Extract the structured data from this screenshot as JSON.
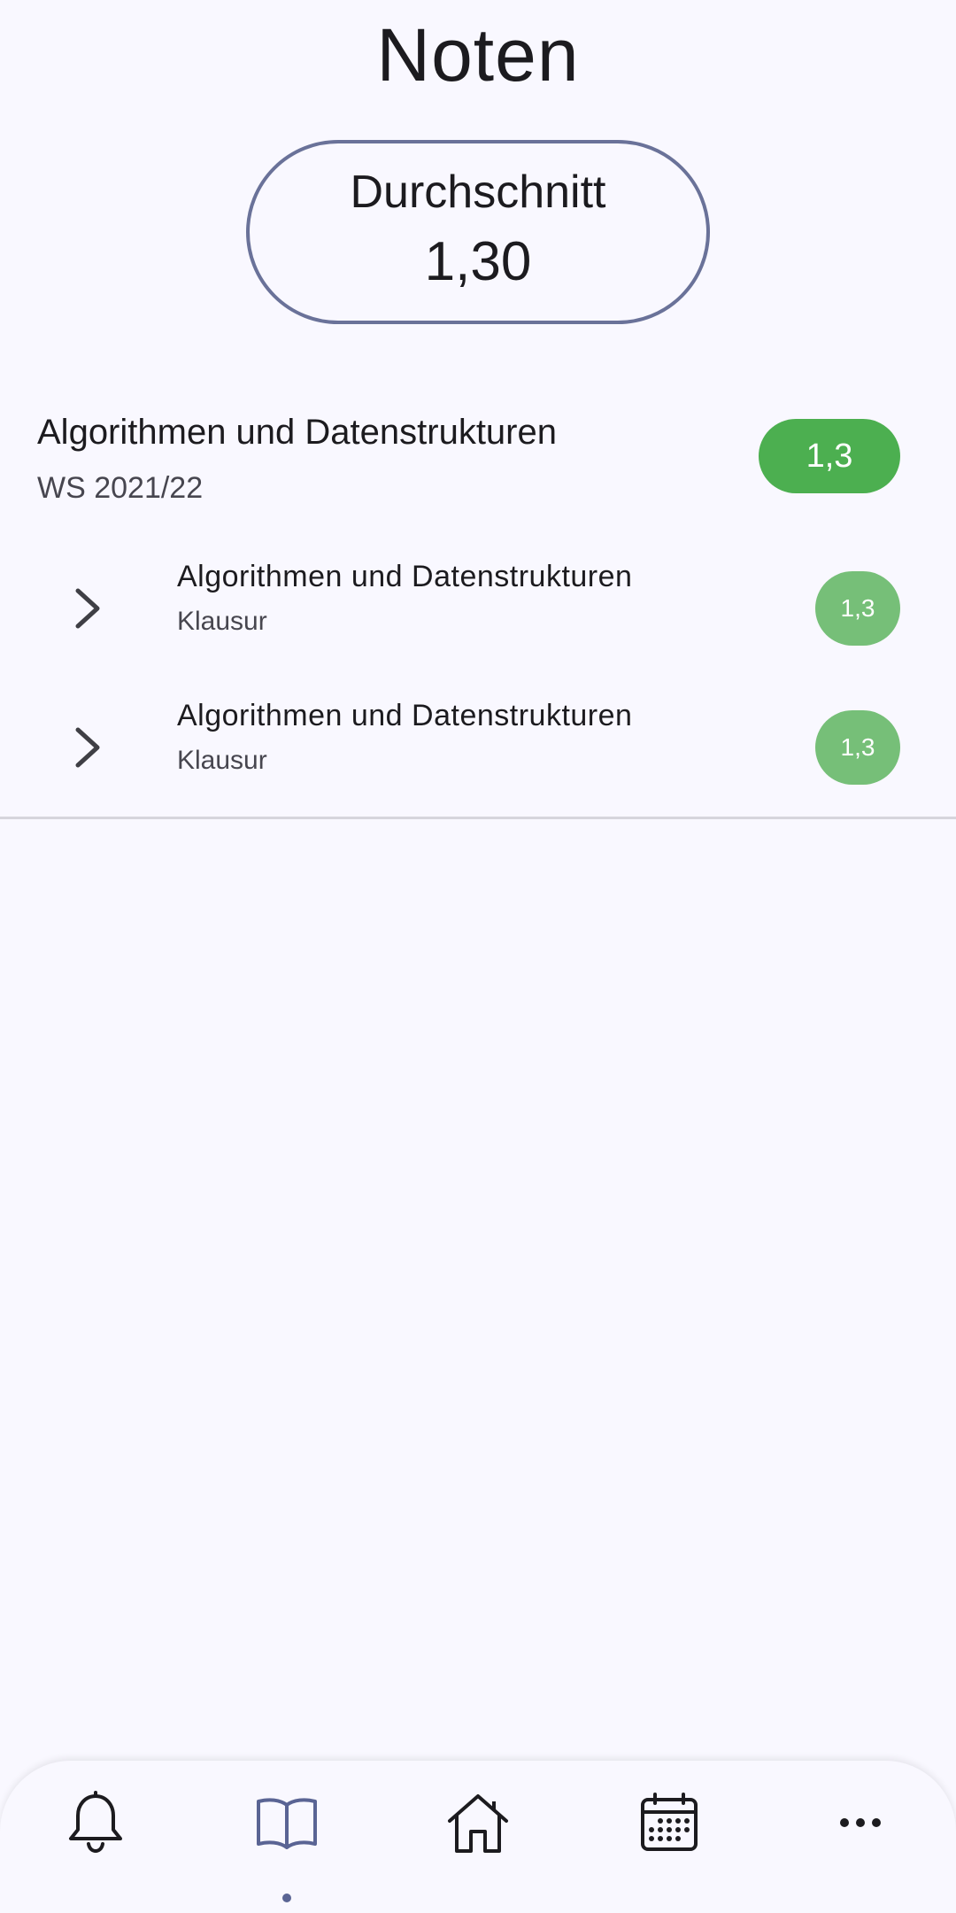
{
  "header": {
    "title": "Noten"
  },
  "average": {
    "label": "Durchschnitt",
    "value": "1,30"
  },
  "module": {
    "title": "Algorithmen und Datenstrukturen",
    "term": "WS 2021/22",
    "grade": "1,3",
    "exams": [
      {
        "name": "Algorithmen und Datenstrukturen",
        "type": "Klausur",
        "grade": "1,3"
      },
      {
        "name": "Algorithmen und Datenstrukturen",
        "type": "Klausur",
        "grade": "1,3"
      }
    ]
  },
  "nav": {
    "items": [
      "bell-icon",
      "book-icon",
      "home-icon",
      "calendar-icon",
      "more-icon"
    ],
    "active": "book-icon"
  },
  "colors": {
    "background": "#f9f8ff",
    "accent": "#6a7299",
    "grade_primary": "#4caf50",
    "grade_secondary": "#76bf78"
  }
}
